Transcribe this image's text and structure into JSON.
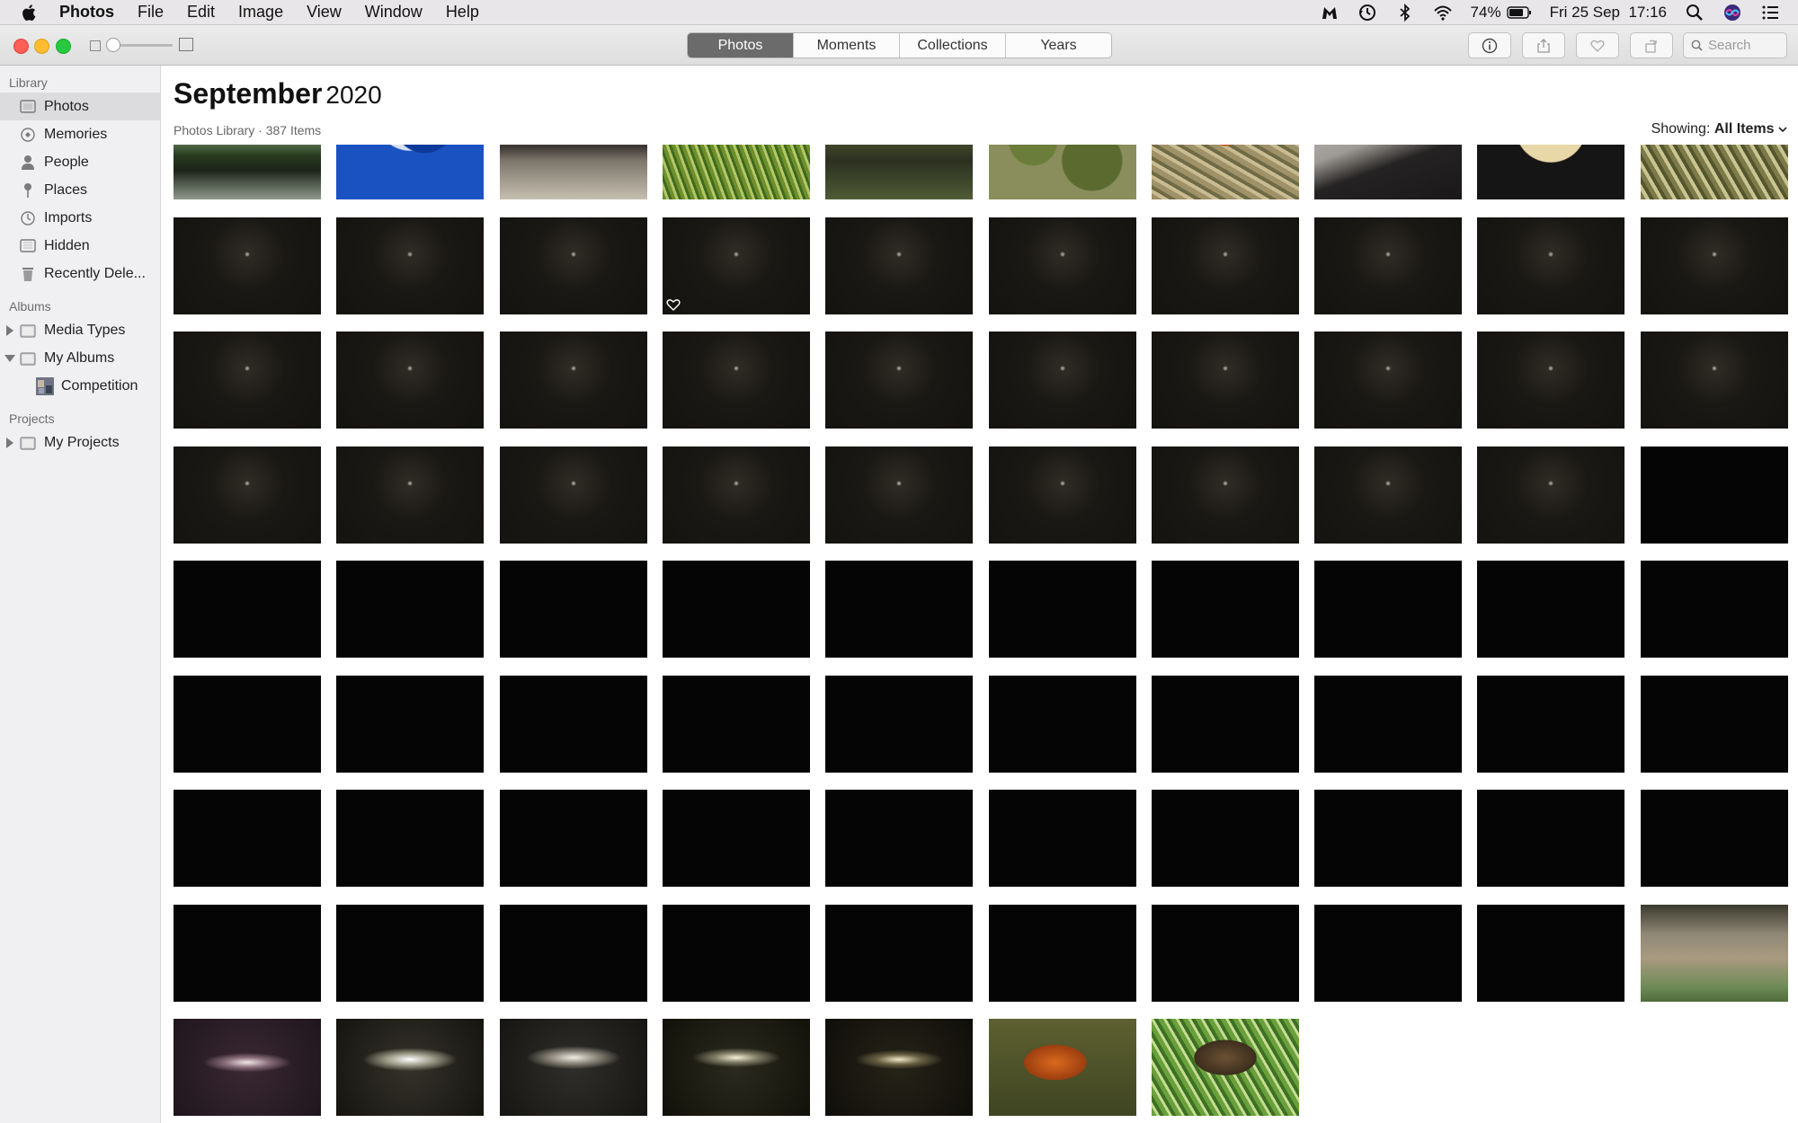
{
  "menubar": {
    "app_name": "Photos",
    "items": [
      "File",
      "Edit",
      "Image",
      "View",
      "Window",
      "Help"
    ],
    "battery": "74%",
    "clock": "Fri 25 Sep  17:16"
  },
  "toolbar": {
    "tabs": [
      {
        "label": "Photos",
        "active": true
      },
      {
        "label": "Moments",
        "active": false
      },
      {
        "label": "Collections",
        "active": false
      },
      {
        "label": "Years",
        "active": false
      }
    ],
    "search_placeholder": "Search"
  },
  "sidebar": {
    "library_heading": "Library",
    "library_items": [
      {
        "label": "Photos",
        "icon": "photos-icon",
        "selected": true
      },
      {
        "label": "Memories",
        "icon": "memories-icon"
      },
      {
        "label": "People",
        "icon": "people-icon"
      },
      {
        "label": "Places",
        "icon": "places-icon"
      },
      {
        "label": "Imports",
        "icon": "imports-icon"
      },
      {
        "label": "Hidden",
        "icon": "hidden-icon"
      },
      {
        "label": "Recently Dele...",
        "icon": "trash-icon"
      }
    ],
    "albums_heading": "Albums",
    "album_items": [
      {
        "label": "Media Types",
        "icon": "folder-icon",
        "disclosure": "right"
      },
      {
        "label": "My Albums",
        "icon": "folder-icon",
        "disclosure": "down"
      },
      {
        "label": "Competition",
        "icon": "album-thumbnail-icon",
        "indent": true
      }
    ],
    "projects_heading": "Projects",
    "project_items": [
      {
        "label": "My Projects",
        "icon": "folder-icon",
        "disclosure": "right"
      }
    ]
  },
  "main": {
    "title_month": "September",
    "title_year": "2020",
    "subtitle": "Photos Library · 387 Items",
    "showing_label": "Showing:",
    "showing_value": "All Items"
  },
  "photo_grid": {
    "rows": [
      [
        "tractor",
        "moon-blue",
        "animals-field",
        "grass",
        "woodland",
        "ivy-leaves",
        "butterfly-twigs",
        "dog-branch",
        "moon-crescent",
        "branches"
      ],
      [
        "night-sky",
        "night-sky",
        "night-sky",
        "night-sky-favorite",
        "night-sky",
        "night-sky",
        "night-sky",
        "night-sky",
        "night-sky",
        "night-sky"
      ],
      [
        "night-sky",
        "night-sky",
        "night-sky",
        "night-sky",
        "night-sky",
        "night-sky",
        "night-sky",
        "night-sky",
        "night-sky",
        "night-sky"
      ],
      [
        "night-sky",
        "night-sky",
        "night-sky",
        "night-sky",
        "night-sky",
        "night-sky",
        "night-sky",
        "night-sky",
        "night-sky",
        "black"
      ],
      [
        "black",
        "black",
        "black",
        "black",
        "black",
        "black",
        "black",
        "black",
        "black",
        "black"
      ],
      [
        "black",
        "black",
        "black",
        "black",
        "black",
        "black",
        "black",
        "black",
        "black",
        "black"
      ],
      [
        "black",
        "black",
        "black",
        "black",
        "black",
        "black",
        "black",
        "black",
        "black",
        "black"
      ],
      [
        "black",
        "black",
        "black",
        "black",
        "black",
        "black",
        "black",
        "black",
        "black",
        "bird-garden"
      ],
      [
        "galaxy-1",
        "galaxy-2",
        "galaxy-3",
        "galaxy-4",
        "galaxy-5",
        "butterfly-comma",
        "butterfly-speckled"
      ]
    ]
  },
  "colors": {
    "accent_tab": "#6b6b6b",
    "sidebar_bg": "#f0eff1",
    "selected_bg": "#dcdbdd"
  }
}
